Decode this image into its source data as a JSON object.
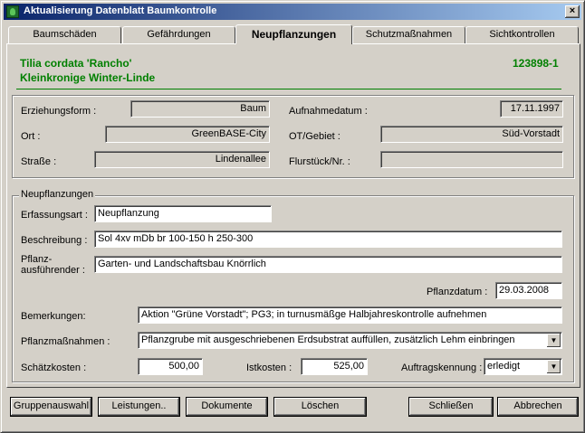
{
  "window": {
    "title": "Aktualisierung Datenblatt Baumkontrolle",
    "close": "×"
  },
  "tabs": [
    "Baumschäden",
    "Gefährdungen",
    "Neupflanzungen",
    "Schutzmaßnahmen",
    "Sichtkontrollen"
  ],
  "tree": {
    "name": "Tilia cordata 'Rancho'",
    "common": "Kleinkronige Winter-Linde",
    "id": "123898-1"
  },
  "info": {
    "erziehungsform_label": "Erziehungsform :",
    "erziehungsform": "Baum",
    "aufnahmedatum_label": "Aufnahmedatum :",
    "aufnahmedatum": "17.11.1997",
    "ort_label": "Ort :",
    "ort": "GreenBASE-City",
    "gebiet_label": "OT/Gebiet :",
    "gebiet": "Süd-Vorstadt",
    "strasse_label": "Straße :",
    "strasse": "Lindenallee",
    "flurstueck_label": "Flurstück/Nr. :",
    "flurstueck": ""
  },
  "neu": {
    "group_title": "Neupflanzungen",
    "erfassungsart_label": "Erfassungsart :",
    "erfassungsart": "Neupflanzung",
    "beschreibung_label": "Beschreibung :",
    "beschreibung": "Sol 4xv mDb br 100-150 h 250-300",
    "ausfuehrender_label1": "Pflanz-",
    "ausfuehrender_label2": "ausführender :",
    "ausfuehrender": "Garten- und Landschaftsbau Knörrlich",
    "pflanzdatum_label": "Pflanzdatum :",
    "pflanzdatum": "29.03.2008",
    "bemerkungen_label": "Bemerkungen:",
    "bemerkungen": "Aktion \"Grüne Vorstadt\"; PG3; in turnusmäßge Halbjahreskontrolle aufnehmen",
    "massnahmen_label": "Pflanzmaßnahmen :",
    "massnahmen": "Pflanzgrube mit ausgeschriebenen Erdsubstrat auffüllen, zusätzlich Lehm einbringen",
    "schaetz_label": "Schätzkosten :",
    "schaetz": "500,00",
    "ist_label": "Istkosten :",
    "ist": "525,00",
    "auftrag_label": "Auftragskennung :",
    "auftrag": "erledigt"
  },
  "buttons": {
    "gruppen": "Gruppenauswahl",
    "leistungen": "Leistungen..",
    "dokumente": "Dokumente",
    "loeschen": "Löschen",
    "schliessen": "Schließen",
    "abbrechen": "Abbrechen"
  },
  "icons": {
    "dropdown": "▼"
  }
}
